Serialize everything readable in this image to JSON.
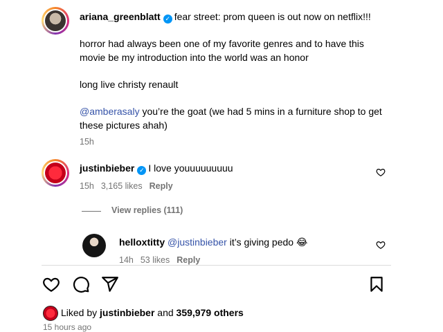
{
  "caption": {
    "username": "ariana_greenblatt",
    "headline": "fear street: prom queen is out now on netflix!!!",
    "paragraph1": "horror had always been one of my favorite genres and to have this movie be my introduction into the world was an honor",
    "paragraph2": "long live christy renault",
    "mention": "@amberasaly",
    "paragraph3": " you’re the goat (we had 5 mins in a furniture shop to get these pictures ahah)",
    "time": "15h"
  },
  "comment": {
    "username": "justinbieber",
    "text": "I love youuuuuuuuu",
    "time": "15h",
    "likes": "3,165 likes",
    "reply_label": "Reply"
  },
  "view_replies": "View replies (111)",
  "reply": {
    "username": "helloxtitty",
    "mention": "@justinbieber",
    "text": " it’s giving pedo ",
    "emoji": "😂",
    "time": "14h",
    "likes": "53 likes",
    "reply_label": "Reply"
  },
  "liked_by": {
    "prefix": "Liked by ",
    "user": "justinbieber",
    "middle": " and ",
    "others": "359,979 others"
  },
  "post_time": "15 hours ago",
  "icons": {
    "like": "heart-icon",
    "comment": "comment-icon",
    "share": "send-icon",
    "save": "bookmark-icon"
  },
  "colors": {
    "verified": "#0095f6",
    "mention": "#3553a8",
    "meta": "#737373"
  }
}
